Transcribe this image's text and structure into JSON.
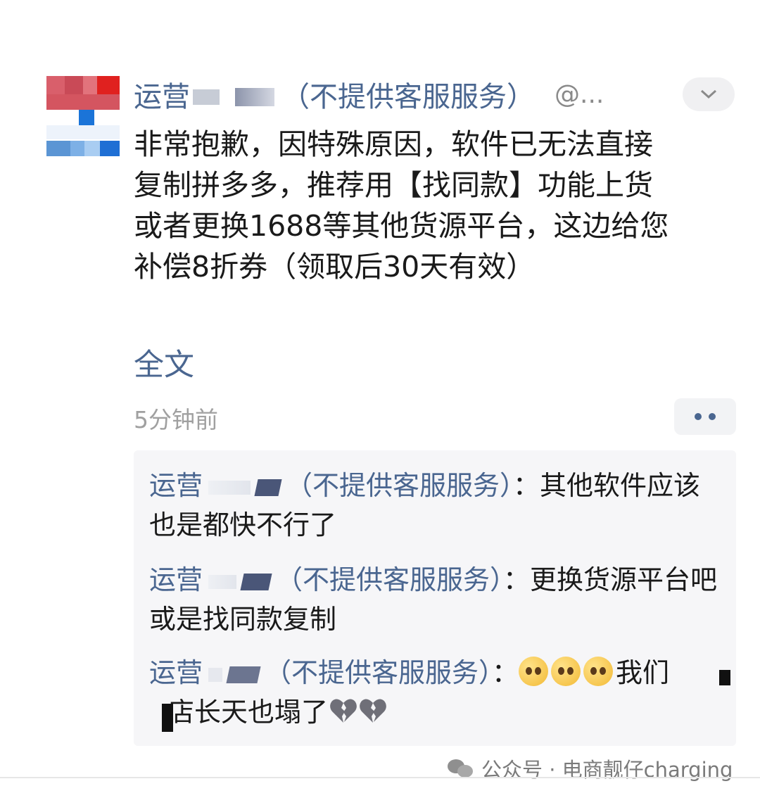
{
  "post": {
    "username": "运营",
    "tag": "（不提供客服服务）",
    "handle": "@...",
    "body": "非常抱歉，因特殊原因，软件已无法直接\n复制拼多多，推荐用【找同款】功能上货\n或者更换1688等其他货源平台，这边给您\n补偿8折券（领取后30天有效）",
    "full_text_link": "全文",
    "time": "5分钟前"
  },
  "comments": [
    {
      "username": "运营",
      "tag": "（不提供客服服务）",
      "separator": "：",
      "text": "其他软件应该也是都快不行了"
    },
    {
      "username": "运营",
      "tag": "（不提供客服服务）",
      "separator": "：",
      "text": "更换货源平台吧或是找同款复制"
    },
    {
      "username": "运营",
      "tag": "（不提供客服服务）",
      "separator": "：",
      "text_before": "我们",
      "text_after": "店长天也塌了"
    }
  ],
  "watermark": {
    "text": "公众号 · 电商靓仔charging"
  },
  "icons": {
    "collapse": "chevron-down-icon",
    "more": "more-dots-icon",
    "emoji": "pleading-face-icon",
    "broken_heart": "broken-heart-icon",
    "wechat": "wechat-icon"
  },
  "colors": {
    "link": "#4a6690",
    "comment_bg": "#f6f6f8"
  }
}
